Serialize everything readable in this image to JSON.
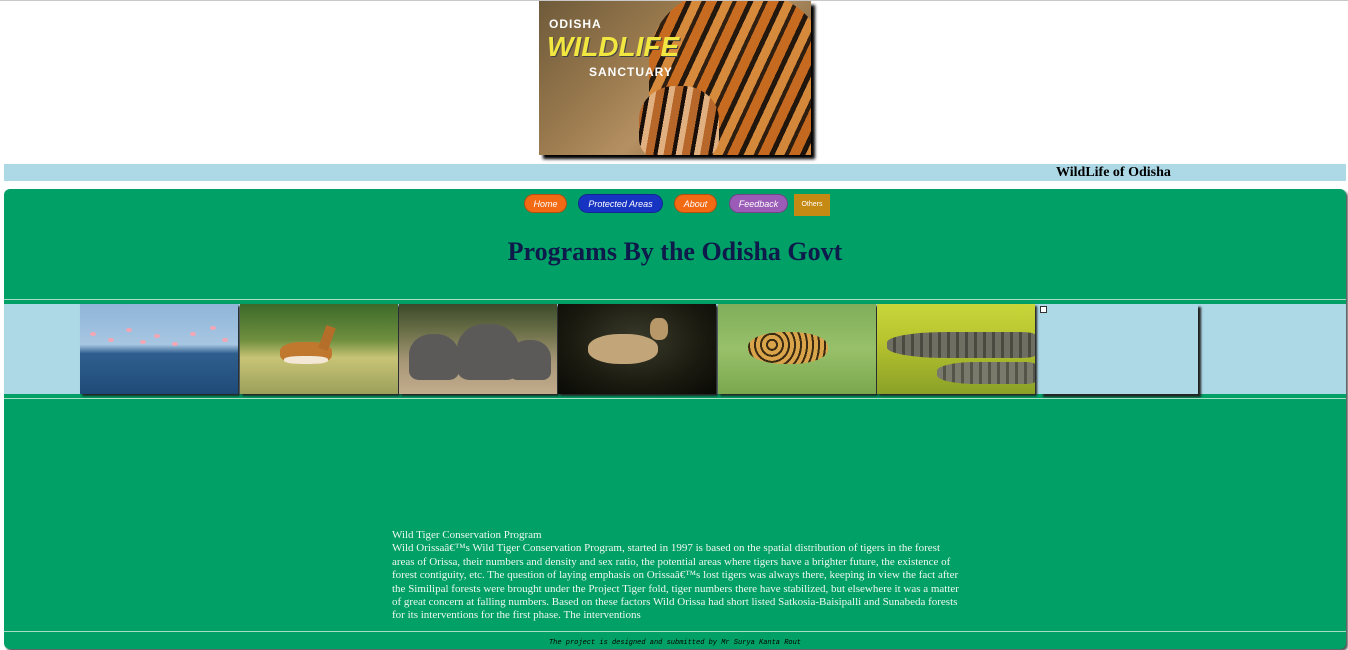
{
  "banner": {
    "line1": "ODISHA",
    "line2": "WILDLIFE",
    "line3": "SANCTUARY"
  },
  "site_title": "WildLife of Odisha",
  "nav": {
    "home": "Home",
    "protected_areas": "Protected Areas",
    "about": "About",
    "feedback": "Feedback",
    "others": "Others"
  },
  "page_heading": "Programs By the Odisha Govt",
  "gallery": [
    {
      "subject": "flamingos"
    },
    {
      "subject": "blackbuck"
    },
    {
      "subject": "elephants"
    },
    {
      "subject": "deer"
    },
    {
      "subject": "leopard"
    },
    {
      "subject": "crocodiles"
    },
    {
      "subject": "broken-image"
    }
  ],
  "article": {
    "title": "Wild Tiger Conservation Program",
    "body": "Wild Orissaâ€™s Wild Tiger Conservation Program, started in 1997 is based on the spatial distribution of tigers in the forest areas of Orissa, their numbers and density and sex ratio, the potential areas where tigers have a brighter future, the existence of forest contiguity, etc. The question of laying emphasis on Orissaâ€™s lost tigers was always there, keeping in view the fact after the Similipal forests were brought under the Project Tiger fold, tiger numbers there have stabilized, but elsewhere it was a matter of great concern at falling numbers. Based on these factors Wild Orissa had short listed Satkosia-Baisipalli and Sunabeda forests for its interventions for the first phase. The interventions"
  },
  "footer": "The project is designed and submitted by Mr Surya Kanta Rout",
  "colors": {
    "title_strip": "#add8e6",
    "main_panel": "#00a067",
    "heading": "#0d1a4a",
    "nav_home": "#f26a14",
    "nav_protected": "#1733c2",
    "nav_feedback": "#9a5cb6",
    "nav_others": "#c48a14"
  }
}
